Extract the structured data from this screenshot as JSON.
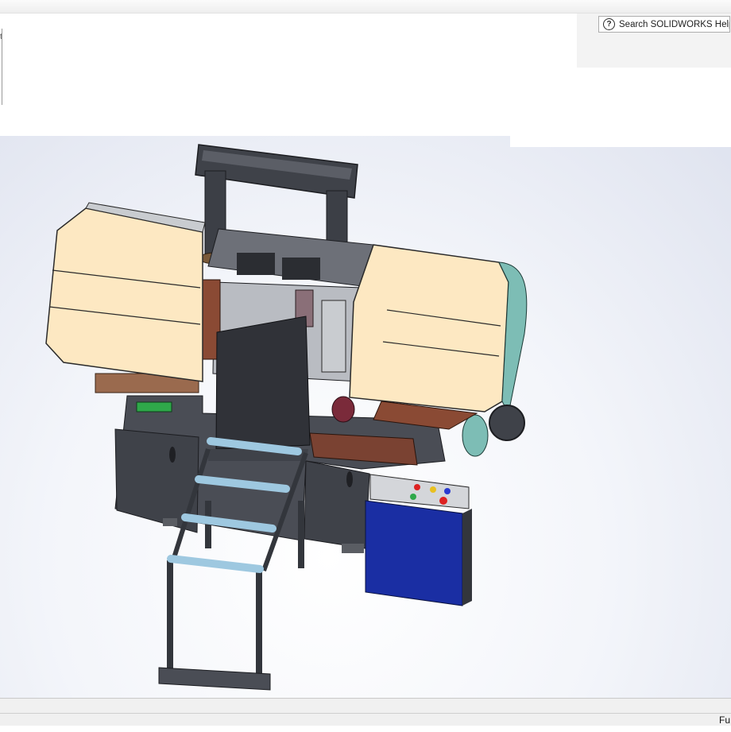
{
  "help_search": {
    "label": "Search SOLIDWORKS Help",
    "icon": "question-circle-icon"
  },
  "left_panel": {
    "fragment": "t"
  },
  "status_bar": {
    "text": "Fu"
  },
  "colors": {
    "viewport_background": "#e6e9f2",
    "guard": "#fde8c2",
    "frame": "#4a4d55",
    "control_cabinet": "#1a2ea3",
    "rollers": "#9ec8e0",
    "belt_wheel": "#7dbdb5"
  }
}
